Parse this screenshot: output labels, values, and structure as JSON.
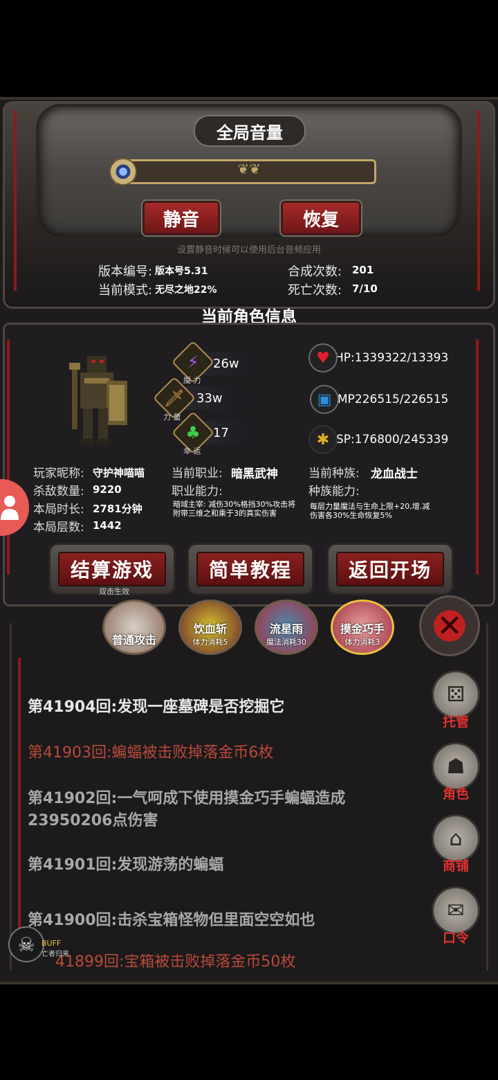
{
  "settings": {
    "title": "全局音量",
    "mute_label": "静音",
    "restore_label": "恢复",
    "hint": "设置静音时候可以使用后台音频应用",
    "version_label": "版本编号:",
    "version_value": "版本号5.31",
    "mode_label": "当前模式:",
    "mode_value": "无尽之地22%",
    "synth_label": "合成次数:",
    "synth_value": "201",
    "death_label": "死亡次数:",
    "death_value": "7/10"
  },
  "character": {
    "section_title": "当前角色信息",
    "stats": [
      {
        "value": "26w",
        "caption": "魔 力",
        "icon": "lightning-icon"
      },
      {
        "value": "33w",
        "caption": "力 量",
        "icon": "sword-icon"
      },
      {
        "value": "17",
        "caption": "幸 运",
        "icon": "clover-icon"
      }
    ],
    "resources": [
      {
        "value": "HP:1339322/13393",
        "icon": "heart-icon"
      },
      {
        "value": "MP226515/226515",
        "icon": "mana-icon"
      },
      {
        "value": "SP:176800/245339",
        "icon": "stamina-icon"
      }
    ],
    "player_label": "玩家昵称:",
    "player_value": "守护神喵喵",
    "kills_label": "杀敌数量:",
    "kills_value": "9220",
    "time_label": "本局时长:",
    "time_value": "2781分钟",
    "floor_label": "本局层数:",
    "floor_value": "1442",
    "job_label": "当前职业:",
    "job_value": "暗黑武神",
    "job_ability_label": "职业能力:",
    "job_ability_text": "暗域主宰: 减伤30%格挡30%攻击将附带三维之和乘于3的真实伤害",
    "race_label": "当前种族:",
    "race_value": "龙血战士",
    "race_ability_label": "种族能力:",
    "race_ability_text": "每层力量魔法与生命上限+20,增.减伤害各30%生命恢复5%"
  },
  "actions": {
    "settle": "结算游戏",
    "settle_caption": "双击生效",
    "tutorial": "简单教程",
    "back": "返回开场"
  },
  "skills": [
    {
      "name": "普通攻击",
      "cost": ""
    },
    {
      "name": "饮血斩",
      "cost": "体力消耗5"
    },
    {
      "name": "流星雨",
      "cost": "魔法消耗30"
    },
    {
      "name": "摸金巧手",
      "cost": "体力消耗3"
    }
  ],
  "log": [
    {
      "text": "第41904回:发现一座墓碑是否挖掘它",
      "color": "#e8e8e8"
    },
    {
      "text": "第41903回:蝙蝠被击败掉落金币6枚",
      "color": "#b84a3a"
    },
    {
      "text": "第41902回:一气呵成下使用摸金巧手蝙蝠造成23950206点伤害",
      "color": "#a8a8a8"
    },
    {
      "text": "第41901回:发现游荡的蝙蝠",
      "color": "#a8a8a8"
    },
    {
      "text": "第41900回:击杀宝箱怪物但里面空空如也",
      "color": "#a8a8a8"
    },
    {
      "text": "41899回:宝箱被击败掉落金币50枚",
      "color": "#b84a3a"
    }
  ],
  "side_menu": [
    {
      "label": "托管",
      "icon": "dice-icon"
    },
    {
      "label": "角色",
      "icon": "hooded-figure-icon"
    },
    {
      "label": "商铺",
      "icon": "shop-icon"
    },
    {
      "label": "口令",
      "icon": "scroll-icon"
    }
  ],
  "buff": {
    "label": "BUFF",
    "name": "亡者归来"
  }
}
